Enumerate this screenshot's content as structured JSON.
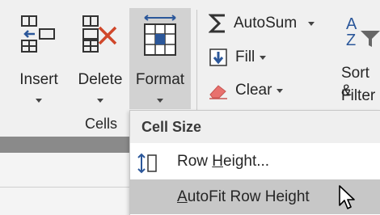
{
  "ribbon": {
    "cells_group": {
      "label": "Cells",
      "insert": {
        "label": "Insert"
      },
      "delete": {
        "label": "Delete"
      },
      "format": {
        "label": "Format"
      }
    },
    "editing_group": {
      "autosum": {
        "label": "AutoSum"
      },
      "fill": {
        "label": "Fill"
      },
      "clear": {
        "label": "Clear"
      },
      "sort_line1": "Sort &",
      "sort_line2": "Filter"
    }
  },
  "format_menu": {
    "section_header": "Cell Size",
    "items": [
      {
        "label_pre": "Row ",
        "label_key": "H",
        "label_post": "eight..."
      },
      {
        "label_pre": "",
        "label_key": "A",
        "label_post": "utoFit Row Height",
        "highlighted": true
      }
    ]
  },
  "colors": {
    "ribbon_bg": "#f0f0f0",
    "pressed_button": "#d2d2d2",
    "menu_highlight": "#c7c7c7",
    "accent_blue": "#2b579a",
    "delete_red": "#d0472a",
    "eraser_pink": "#e8716e"
  },
  "icons": [
    "insert-cells-icon",
    "delete-cells-icon",
    "format-cells-icon",
    "autosum-sigma-icon",
    "fill-down-icon",
    "clear-eraser-icon",
    "sort-filter-icon",
    "row-height-icon",
    "mouse-pointer-icon"
  ]
}
